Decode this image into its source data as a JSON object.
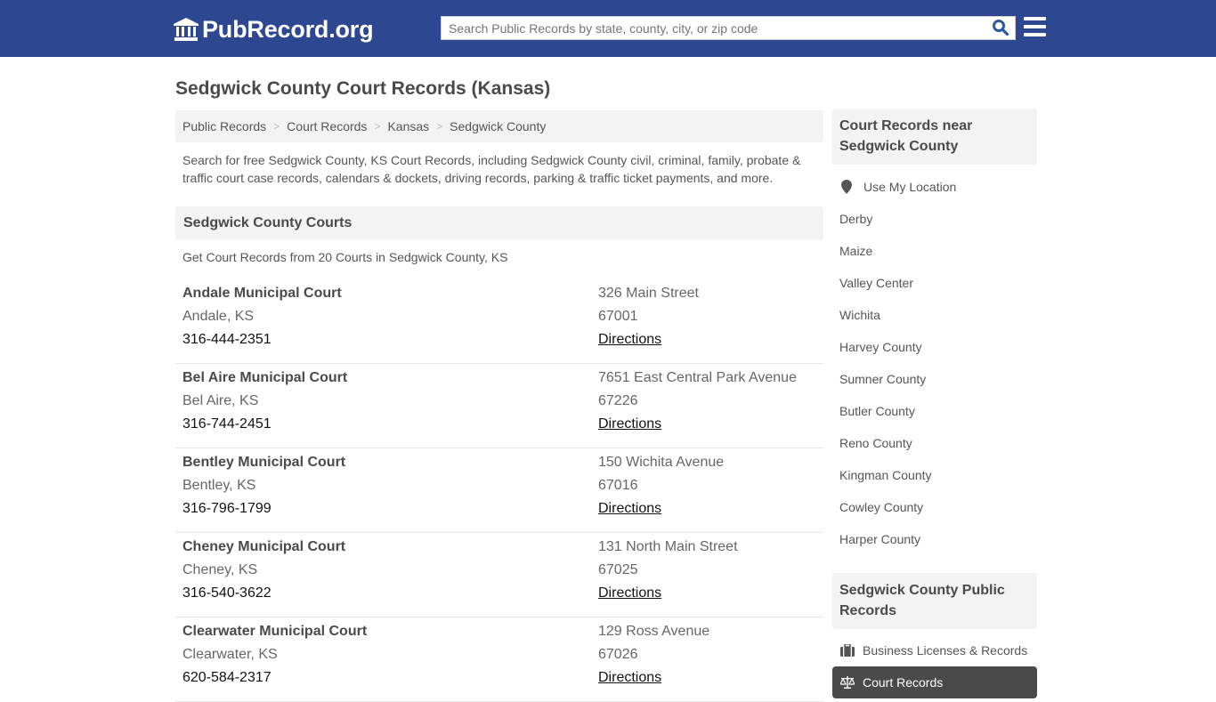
{
  "header": {
    "logo_text": "PubRecord.org",
    "search_placeholder": "Search Public Records by state, county, city, or zip code"
  },
  "page": {
    "title": "Sedgwick County Court Records (Kansas)",
    "breadcrumb": [
      "Public Records",
      "Court Records",
      "Kansas",
      "Sedgwick County"
    ],
    "intro": "Search for free Sedgwick County, KS Court Records, including Sedgwick County civil, criminal, family, probate & traffic court case records, calendars & dockets, driving records, parking & traffic ticket payments, and more."
  },
  "courts_section": {
    "heading": "Sedgwick County Courts",
    "subheading": "Get Court Records from 20 Courts in Sedgwick County, KS",
    "directions_label": "Directions",
    "courts": [
      {
        "name": "Andale Municipal Court",
        "city": "Andale, KS",
        "phone": "316-444-2351",
        "address": "326 Main Street",
        "zip": "67001"
      },
      {
        "name": "Bel Aire Municipal Court",
        "city": "Bel Aire, KS",
        "phone": "316-744-2451",
        "address": "7651 East Central Park Avenue",
        "zip": "67226"
      },
      {
        "name": "Bentley Municipal Court",
        "city": "Bentley, KS",
        "phone": "316-796-1799",
        "address": "150 Wichita Avenue",
        "zip": "67016"
      },
      {
        "name": "Cheney Municipal Court",
        "city": "Cheney, KS",
        "phone": "316-540-3622",
        "address": "131 North Main Street",
        "zip": "67025"
      },
      {
        "name": "Clearwater Municipal Court",
        "city": "Clearwater, KS",
        "phone": "620-584-2317",
        "address": "129 Ross Avenue",
        "zip": "67026"
      }
    ]
  },
  "sidebar": {
    "near_heading": "Court Records near Sedgwick County",
    "use_location": "Use My Location",
    "near_items": [
      "Derby",
      "Maize",
      "Valley Center",
      "Wichita",
      "Harvey County",
      "Sumner County",
      "Butler County",
      "Reno County",
      "Kingman County",
      "Cowley County",
      "Harper County"
    ],
    "public_heading": "Sedgwick County Public Records",
    "public_items": [
      {
        "label": "Business Licenses & Records",
        "icon": "briefcase-icon",
        "active": false
      },
      {
        "label": "Court Records",
        "icon": "scales-icon",
        "active": true
      }
    ]
  },
  "colors": {
    "brand": "#2d4790",
    "active_item": "#4a4a4a",
    "panel_bg": "#f3f3f3"
  }
}
